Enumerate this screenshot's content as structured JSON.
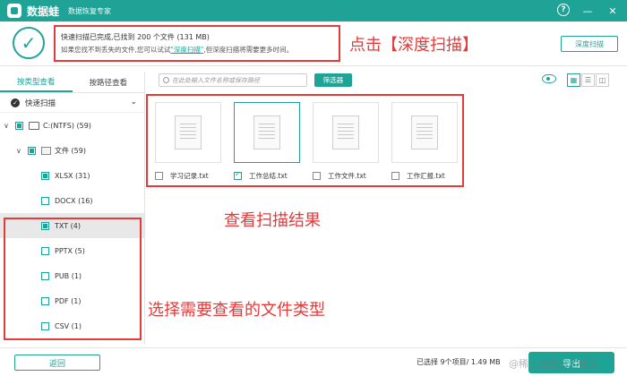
{
  "app": {
    "name": "数据蛙",
    "subtitle": "数据恢复专家"
  },
  "window": {
    "help": "?",
    "minimize": "—",
    "close": "✕"
  },
  "scan": {
    "status": "快速扫描已完成,已找到 200 个文件 (131 MB)",
    "hint_prefix": "如果您找不到丢失的文件,您可以试试",
    "hint_link": "\"深度扫描\"",
    "hint_suffix": ",但深度扫描将需要更多时间。",
    "deep_scan_button": "深度扫描"
  },
  "annotations": {
    "click_deep": "点击【深度扫描】",
    "view_results": "查看扫描结果",
    "choose_type": "选择需要查看的文件类型"
  },
  "sidebar": {
    "tabs": [
      {
        "label": "按类型查看",
        "active": true
      },
      {
        "label": "按路径查看",
        "active": false
      }
    ],
    "quick_scan": "快速扫描",
    "drive": "C:(NTFS) (59)",
    "folder": "文件 (59)",
    "types": [
      {
        "label": "XLSX (31)",
        "checked": "partial"
      },
      {
        "label": "DOCX (16)",
        "checked": "empty"
      },
      {
        "label": "TXT (4)",
        "checked": "partial",
        "selected": true
      },
      {
        "label": "PPTX (5)",
        "checked": "empty"
      },
      {
        "label": "PUB (1)",
        "checked": "empty"
      },
      {
        "label": "PDF (1)",
        "checked": "empty"
      },
      {
        "label": "CSV (1)",
        "checked": "empty"
      }
    ]
  },
  "toolbar": {
    "search_placeholder": "在此处输入文件名称或保存路径",
    "filter_button": "筛选器",
    "view_grid": "▦",
    "view_list": "☰",
    "view_detail": "◫"
  },
  "files": [
    {
      "name": "学习记录.txt",
      "checked": false
    },
    {
      "name": "工作总结.txt",
      "checked": true
    },
    {
      "name": "工作文件.txt",
      "checked": false
    },
    {
      "name": "工作汇报.txt",
      "checked": false
    }
  ],
  "footer": {
    "back_button": "返回",
    "selection_info": "已选择 9个项目/ 1.49 MB",
    "export_button": "导出",
    "watermark": "@稀土掘金技术社区"
  },
  "colors": {
    "accent": "#1fa396",
    "annotation": "#e23b3b"
  }
}
